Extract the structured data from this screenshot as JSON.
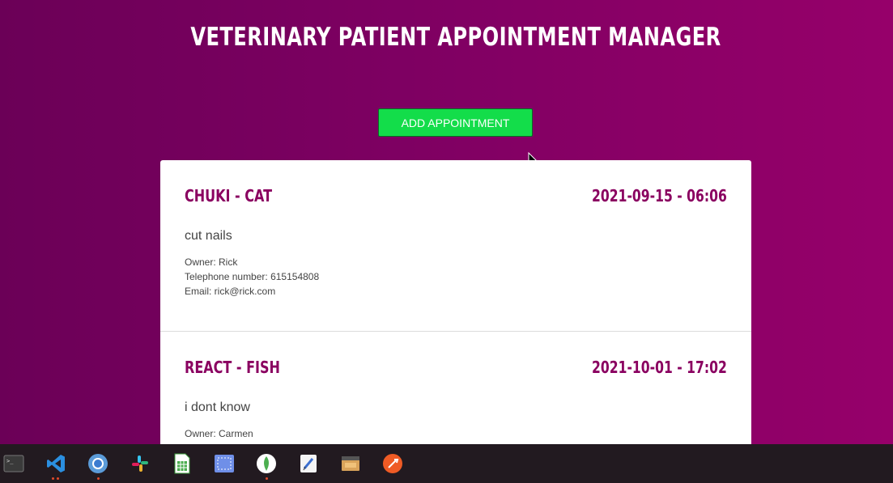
{
  "header": {
    "title": "Veterinary Patient Appointment Manager"
  },
  "toolbar": {
    "add_label": "ADD APPOINTMENT"
  },
  "appointments": [
    {
      "pet": "CHUKI - CAT",
      "date": "2021-09-15 - 06:06",
      "symptoms": "cut nails",
      "owner": "Owner: Rick",
      "phone": "Telephone number: 615154808",
      "email": "Email: rick@rick.com"
    },
    {
      "pet": "REACT - FISH",
      "date": "2021-10-01 - 17:02",
      "symptoms": "i dont know",
      "owner": "Owner: Carmen"
    }
  ],
  "colors": {
    "background_start": "#6b0057",
    "background_end": "#96006a",
    "accent": "#8a0060",
    "button": "#13dd4a",
    "taskbar": "#221a20"
  },
  "taskbar": {
    "icons": [
      "terminal-icon",
      "vscode-icon",
      "chromium-icon",
      "slack-icon",
      "spreadsheet-icon",
      "screenshot-icon",
      "mongodb-icon",
      "text-editor-icon",
      "archive-icon",
      "postman-icon"
    ]
  }
}
